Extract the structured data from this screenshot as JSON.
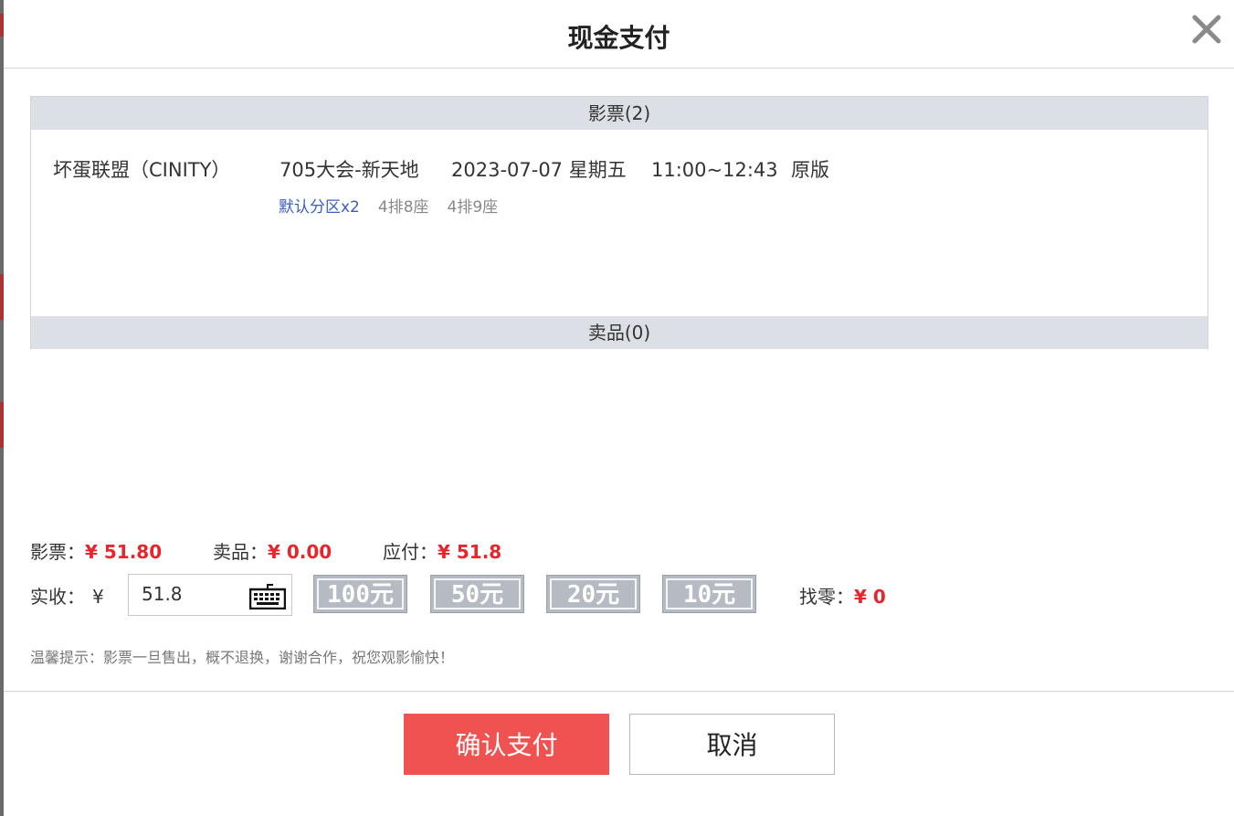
{
  "dialog": {
    "title": "现金支付"
  },
  "tickets_section": {
    "header": "影票(2)",
    "items": [
      {
        "movie": "坏蛋联盟（CINITY）",
        "hall": "705大会-新天地",
        "date": "2023-07-07 星期五",
        "time": "11:00~12:43",
        "version": "原版",
        "zone": "默认分区x2",
        "seats": [
          "4排8座",
          "4排9座"
        ]
      }
    ]
  },
  "goods_section": {
    "header": "卖品(0)"
  },
  "summary": {
    "ticket_label": "影票：",
    "ticket_amount": "¥ 51.80",
    "goods_label": "卖品：",
    "goods_amount": "¥ 0.00",
    "due_label": "应付：",
    "due_amount": "¥ 51.8"
  },
  "payment": {
    "received_label": "实收：",
    "currency_symbol": "¥",
    "received_value": "51.8",
    "keyboard_icon": "keyboard-icon",
    "quick_amounts": [
      "100元",
      "50元",
      "20元",
      "10元"
    ],
    "change_label": "找零：",
    "change_amount": "¥ 0"
  },
  "tip": "温馨提示：影票一旦售出，概不退换，谢谢合作，祝您观影愉快！",
  "buttons": {
    "confirm": "确认支付",
    "cancel": "取消"
  },
  "colors": {
    "accent_red": "#e8242c",
    "confirm_bg": "#f05252",
    "section_bg": "#dcdfe6",
    "link_blue": "#3a5fbf"
  }
}
